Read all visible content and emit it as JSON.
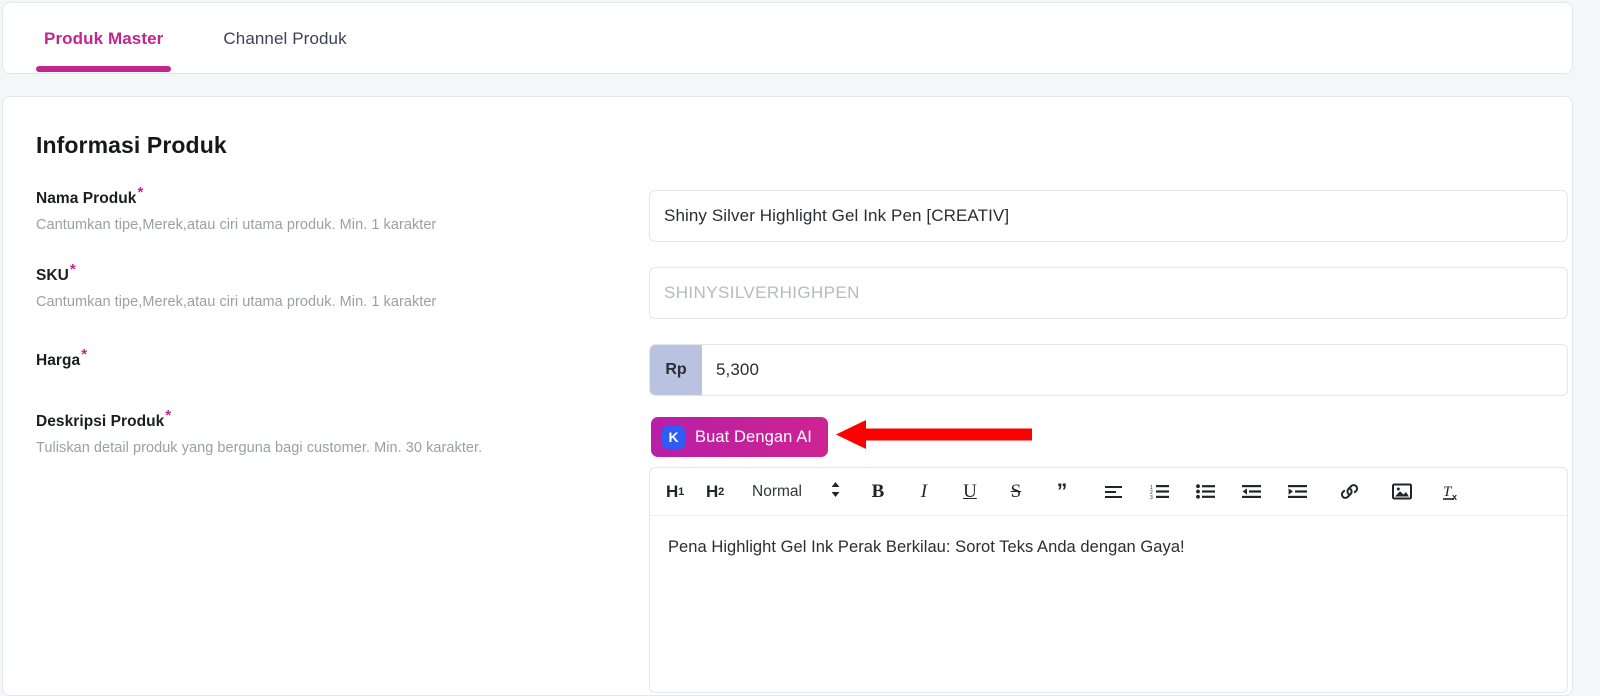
{
  "tabs": [
    {
      "label": "Produk Master",
      "active": true
    },
    {
      "label": "Channel Produk",
      "active": false
    }
  ],
  "section": {
    "title": "Informasi Produk"
  },
  "fields": {
    "nama_produk": {
      "label": "Nama Produk",
      "required_marker": "*",
      "hint": "Cantumkan tipe,Merek,atau ciri utama produk. Min. 1 karakter",
      "value": "Shiny Silver Highlight Gel Ink Pen [CREATIV]",
      "placeholder": ""
    },
    "sku": {
      "label": "SKU",
      "required_marker": "*",
      "hint": "Cantumkan tipe,Merek,atau ciri utama produk. Min. 1 karakter",
      "value": "",
      "placeholder": "SHINYSILVERHIGHPEN"
    },
    "harga": {
      "label": "Harga",
      "required_marker": "*",
      "hint": "",
      "currency_prefix": "Rp",
      "value": "5,300"
    },
    "deskripsi_produk": {
      "label": "Deskripsi Produk",
      "required_marker": "*",
      "hint": "Tuliskan detail produk yang berguna bagi customer. Min. 30 karakter."
    }
  },
  "ai_button": {
    "label": "Buat Dengan AI",
    "icon": "k-badge-icon",
    "badge_letter": "K",
    "background_color": "#c2219a",
    "badge_color": "#2f5cf5"
  },
  "annotation": {
    "type": "arrow",
    "direction": "left",
    "color": "#ff0000",
    "points_to": "Buat Dengan AI"
  },
  "editor": {
    "toolbar": {
      "h1": "H1",
      "h1_main": "H",
      "h1_sub": "1",
      "h2_main": "H",
      "h2_sub": "2",
      "format_select": "Normal",
      "bold": "B",
      "italic": "I",
      "underline": "U",
      "strike": "S",
      "quote": "”",
      "items": [
        "heading-1-icon",
        "heading-2-icon",
        "format-select",
        "bold-icon",
        "italic-icon",
        "underline-icon",
        "strikethrough-icon",
        "blockquote-icon",
        "align-icon",
        "ordered-list-icon",
        "bullet-list-icon",
        "outdent-icon",
        "indent-icon",
        "link-icon",
        "image-icon",
        "clear-format-icon"
      ]
    },
    "content": "Pena Highlight Gel Ink Perak Berkilau: Sorot Teks Anda dengan Gaya!"
  },
  "theme": {
    "accent": "#c2258f",
    "page_background": "#f5f6f7",
    "card_background": "#ffffff",
    "border": "#e3e7ec",
    "hint_text": "#9aa0a8"
  }
}
